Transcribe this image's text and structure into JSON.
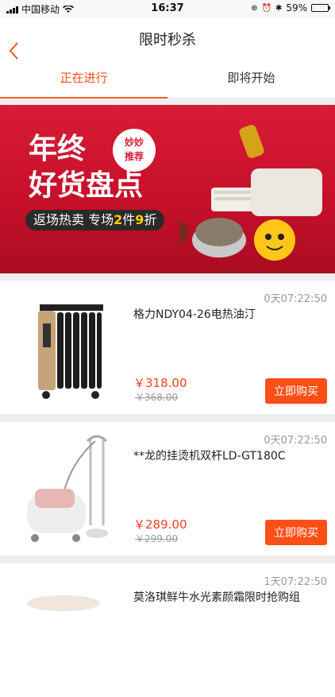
{
  "status_bar": {
    "carrier": "中国移动",
    "time": "16:37",
    "battery": "59%",
    "battery_level": 0.59
  },
  "nav": {
    "title": "限时秒杀",
    "back_icon": "chevron-left-icon"
  },
  "tabs": [
    {
      "label": "正在进行",
      "active": true
    },
    {
      "label": "即将开始",
      "active": false
    }
  ],
  "banner": {
    "line1": "年终",
    "line2": "好货盘点",
    "badge_line1": "妙妙",
    "badge_line2": "推荐",
    "pill_prefix": "返场热卖 专场",
    "pill_num1": "2",
    "pill_mid": "件",
    "pill_num2": "9",
    "pill_suffix": "折",
    "colors": {
      "bg": "#d81c35"
    }
  },
  "products": [
    {
      "timer": "0天07:22:50",
      "name": "格力NDY04-26电热油汀",
      "price": "￥318.00",
      "original_price": "￥368.00",
      "buy_label": "立即购买"
    },
    {
      "timer": "0天07:22:50",
      "name": "**龙的挂烫机双杆LD-GT180C",
      "price": "￥289.00",
      "original_price": "￥299.00",
      "buy_label": "立即购买"
    },
    {
      "timer": "1天07:22:50",
      "name": "莫洛琪鲜牛水光素颜霜限时抢购组",
      "price": "",
      "original_price": "",
      "buy_label": ""
    }
  ],
  "colors": {
    "accent": "#ff4f17",
    "price": "#ff3c1f"
  }
}
